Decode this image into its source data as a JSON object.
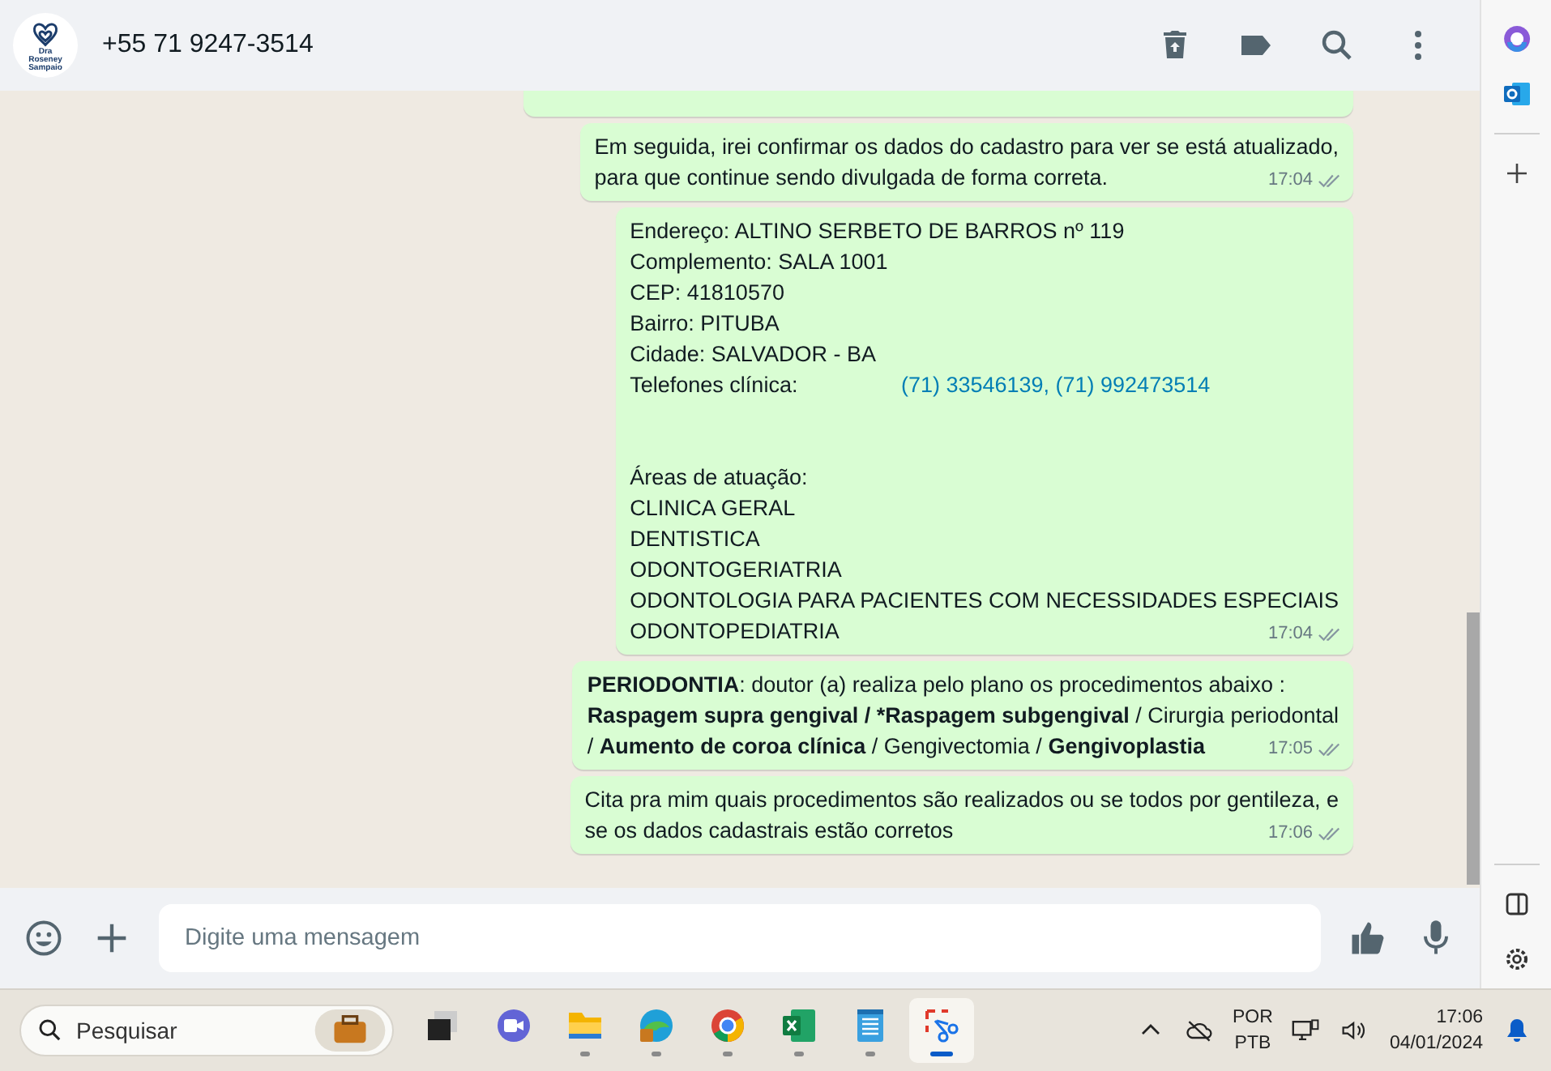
{
  "header": {
    "avatar_label": "Dra Roseney Sampaio",
    "contact": "+55 71 9247-3514"
  },
  "messages": [
    {
      "kind": "partial"
    },
    {
      "kind": "text",
      "lines": [
        [
          {
            "t": "Em seguida, irei confirmar os dados do cadastro para ver se está atualizado,",
            "b": false
          }
        ],
        [
          {
            "t": "para que continue sendo divulgada de forma correta.",
            "b": false
          }
        ]
      ],
      "time": "17:04"
    },
    {
      "kind": "blocks",
      "blocks": [
        [
          {
            "text": "Endereço: ALTINO SERBETO DE BARROS nº 119"
          },
          {
            "text": "Complemento: SALA 1001"
          },
          {
            "text": "CEP: 41810570"
          },
          {
            "text": "Bairro: PITUBA"
          },
          {
            "text": "Cidade: SALVADOR - BA"
          },
          {
            "text": "Telefones clínica: ",
            "link": "(71) 33546139, (71) 992473514"
          }
        ],
        [
          {
            "text": "Áreas de atuação:"
          },
          {
            "text": "CLINICA GERAL"
          },
          {
            "text": "DENTISTICA"
          },
          {
            "text": "ODONTOGERIATRIA"
          },
          {
            "text": "ODONTOLOGIA PARA PACIENTES COM NECESSIDADES ESPECIAIS"
          },
          {
            "text": "ODONTOPEDIATRIA"
          }
        ]
      ],
      "time": "17:04"
    },
    {
      "kind": "text",
      "lines": [
        [
          {
            "t": "PERIODONTIA",
            "b": true
          },
          {
            "t": ":  doutor (a) realiza pelo plano os procedimentos abaixo :",
            "b": false
          }
        ],
        [
          {
            "t": "Raspagem supra gengival / *Raspagem subgengival",
            "b": true
          },
          {
            "t": "  /  Cirurgia periodontal",
            "b": false
          }
        ],
        [
          {
            "t": "/  ",
            "b": false
          },
          {
            "t": "Aumento de coroa clínica",
            "b": true
          },
          {
            "t": " /  Gengivectomia  /   ",
            "b": false
          },
          {
            "t": "Gengivoplastia",
            "b": true
          }
        ]
      ],
      "time": "17:05"
    },
    {
      "kind": "text",
      "lines": [
        [
          {
            "t": "Cita pra mim quais procedimentos são realizados ou se todos por gentileza, e",
            "b": false
          }
        ],
        [
          {
            "t": "se os dados cadastrais estão corretos",
            "b": false
          }
        ]
      ],
      "time": "17:06"
    }
  ],
  "composer": {
    "placeholder": "Digite uma mensagem"
  },
  "taskbar": {
    "search": {
      "placeholder": "Pesquisar"
    },
    "apps": [
      {
        "kind": "taskview",
        "running": false,
        "selected": false
      },
      {
        "kind": "teams",
        "running": false,
        "selected": false
      },
      {
        "kind": "explorer",
        "running": true,
        "selected": false
      },
      {
        "kind": "edge",
        "running": true,
        "selected": false
      },
      {
        "kind": "chrome",
        "running": true,
        "selected": false
      },
      {
        "kind": "excel",
        "running": true,
        "selected": false
      },
      {
        "kind": "notepad",
        "running": true,
        "selected": false
      },
      {
        "kind": "snip",
        "running": true,
        "selected": true
      }
    ],
    "language": [
      "POR",
      "PTB"
    ],
    "time": "17:06",
    "date": "04/01/2024"
  }
}
